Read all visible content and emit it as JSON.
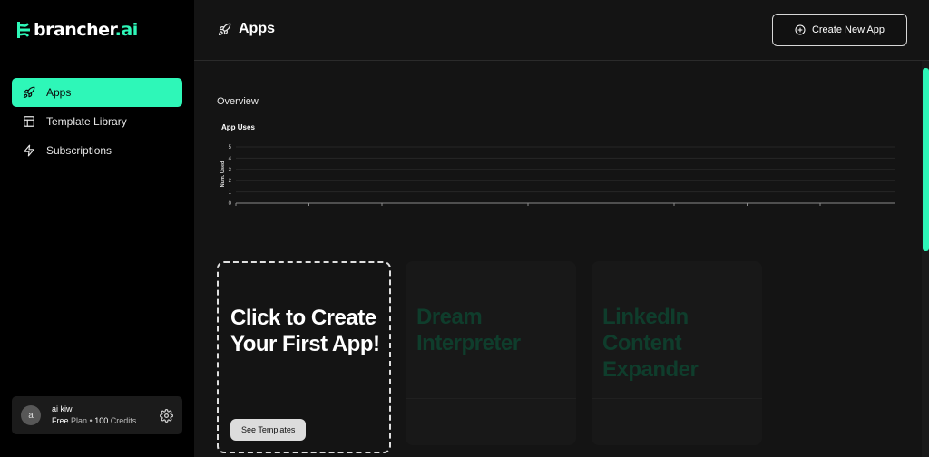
{
  "brand": {
    "name": "brancher",
    "suffix": ".ai"
  },
  "sidebar": {
    "items": [
      {
        "label": "Apps",
        "icon": "rocket-icon",
        "active": true
      },
      {
        "label": "Template Library",
        "icon": "layout-icon",
        "active": false
      },
      {
        "label": "Subscriptions",
        "icon": "lightning-icon",
        "active": false
      }
    ]
  },
  "user": {
    "initial": "a",
    "name": "ai kiwi",
    "plan": "Free",
    "plan_suffix": "Plan •",
    "credits": "100",
    "credits_suffix": "Credits"
  },
  "header": {
    "title": "Apps",
    "create_button": "Create New App"
  },
  "overview": {
    "label": "Overview"
  },
  "chart_data": {
    "type": "line",
    "title": "App Uses",
    "ylabel": "Num. Used",
    "xlabel": "",
    "yticks": [
      "0",
      "1",
      "2",
      "3",
      "4",
      "5"
    ],
    "ylim": [
      0,
      5
    ],
    "x_tick_count": 9,
    "series": []
  },
  "cards": {
    "first": {
      "heading": "Click to Create Your First App!",
      "button": "See Templates"
    },
    "apps": [
      {
        "heading": "Dream Interpreter"
      },
      {
        "heading": "LinkedIn Content Expander"
      }
    ]
  },
  "colors": {
    "accent": "#2ef7b8",
    "sidebar_bg": "#000000",
    "main_bg": "#141414",
    "card_title_dim": "#0f3d2c"
  }
}
